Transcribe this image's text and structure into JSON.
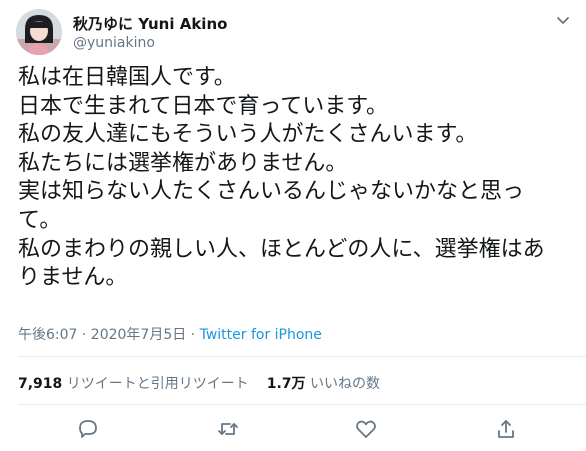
{
  "author": {
    "display_name": "秋乃ゆに Yuni Akino",
    "handle": "@yuniakino"
  },
  "tweet": {
    "lines": [
      "私は在日韓国人です。",
      "日本で生まれて日本で育っています。",
      "私の友人達にもそういう人がたくさんいます。",
      "私たちには選挙権がありません。",
      "実は知らない人たくさんいるんじゃないかなと思っ",
      "て。",
      "私のまわりの親しい人、ほとんどの人に、選挙権はあ",
      "りません。"
    ]
  },
  "meta": {
    "timestamp": "午後6:07 · 2020年7月5日",
    "separator": " · ",
    "source": "Twitter for iPhone"
  },
  "stats": {
    "retweets_count": "7,918",
    "retweets_label": "リツイートと引用リツイート",
    "likes_count": "1.7万",
    "likes_label": "いいねの数"
  },
  "icons": {
    "caret": "chevron-down-icon",
    "reply": "reply-icon",
    "retweet": "retweet-icon",
    "like": "heart-icon",
    "share": "share-icon"
  },
  "colors": {
    "text": "#14171a",
    "secondary": "#657786",
    "link": "#1b95e0",
    "divider": "#e6ecf0"
  }
}
